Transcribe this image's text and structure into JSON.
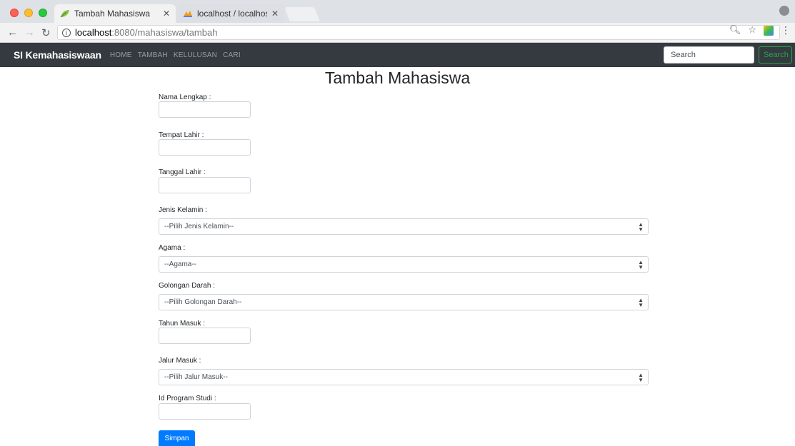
{
  "browser": {
    "tabs": [
      {
        "title": "Tambah Mahasiswa",
        "active": true
      },
      {
        "title": "localhost / localhost / si_kemah",
        "active": false
      }
    ],
    "url_host": "localhost",
    "url_rest": ":8080/mahasiswa/tambah"
  },
  "navbar": {
    "brand": "SI Kemahasiswaan",
    "links": [
      "HOME",
      "TAMBAH",
      "KELULUSAN",
      "CARI"
    ],
    "search_placeholder": "Search",
    "search_button": "Search"
  },
  "form": {
    "title": "Tambah Mahasiswa",
    "nama_lengkap_label": "Nama Lengkap :",
    "tempat_lahir_label": "Tempat Lahir :",
    "tanggal_lahir_label": "Tanggal Lahir :",
    "jenis_kelamin_label": "Jenis Kelamin :",
    "jenis_kelamin_selected": "--Pilih Jenis Kelamin--",
    "agama_label": "Agama :",
    "agama_selected": "--Agama--",
    "golongan_darah_label": "Golongan Darah :",
    "golongan_darah_selected": "--Pilih Golongan Darah--",
    "tahun_masuk_label": "Tahun Masuk :",
    "jalur_masuk_label": "Jalur Masuk :",
    "jalur_masuk_selected": "--Pilih Jalur Masuk--",
    "id_program_studi_label": "Id Program Studi :",
    "submit_label": "Simpan"
  },
  "colors": {
    "navbar_bg": "#343a40",
    "primary": "#007bff",
    "success": "#28a745"
  }
}
